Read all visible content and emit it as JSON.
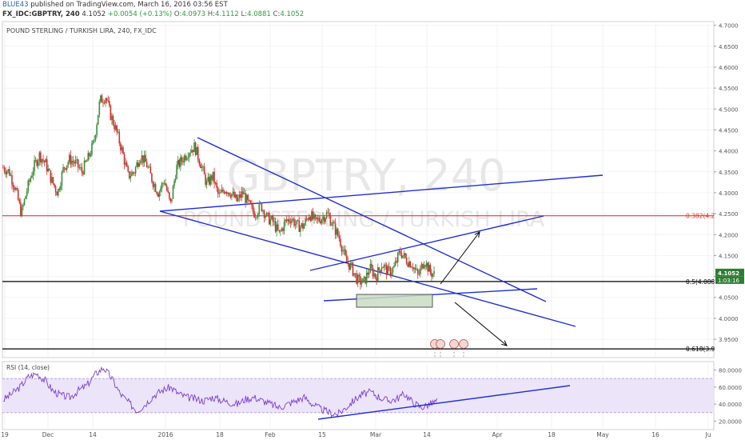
{
  "header": {
    "author": "BLUE43",
    "published_text": "published on TradingView.com, March 16, 2016 03:56 EST",
    "symbol": "FX_IDC:GBPTRY, 240",
    "last": "4.1052",
    "change": "+0.0054 (+0.13%)",
    "open_label": "O:",
    "open": "4.0973",
    "high_label": "H:",
    "high": "4.1112",
    "low_label": "L:",
    "low": "4.0881",
    "close_label": "C:",
    "close": "4.1052"
  },
  "chart_data": [
    {
      "type": "candlestick",
      "title": "POUND STERLING / TURKISH LIRA, 240, FX_IDC",
      "watermark_symbol": "GBPTRY, 240",
      "watermark_name": "POUND STERLING / TURKISH LIRA",
      "ylim": [
        3.91,
        4.705
      ],
      "y_ticks": [
        "4.7000",
        "4.6500",
        "4.6000",
        "4.5500",
        "4.5000",
        "4.4500",
        "4.4000",
        "4.3500",
        "4.3000",
        "4.2500",
        "4.2000",
        "4.1500",
        "4.1000",
        "4.0500",
        "4.0000",
        "3.9500"
      ],
      "x_ticks": [
        "19",
        "Dec",
        "14",
        "2016",
        "18",
        "Feb",
        "15",
        "Mar",
        "14",
        "Apr",
        "18",
        "May",
        "16",
        "Ju"
      ],
      "price_path": [
        [
          0,
          4.36
        ],
        [
          3,
          4.35
        ],
        [
          6,
          4.31
        ],
        [
          9,
          4.25
        ],
        [
          12,
          4.31
        ],
        [
          15,
          4.36
        ],
        [
          18,
          4.39
        ],
        [
          21,
          4.37
        ],
        [
          24,
          4.33
        ],
        [
          27,
          4.3
        ],
        [
          30,
          4.36
        ],
        [
          33,
          4.38
        ],
        [
          36,
          4.37
        ],
        [
          39,
          4.35
        ],
        [
          42,
          4.38
        ],
        [
          45,
          4.42
        ],
        [
          48,
          4.52
        ],
        [
          51,
          4.53
        ],
        [
          53,
          4.49
        ],
        [
          56,
          4.45
        ],
        [
          59,
          4.4
        ],
        [
          62,
          4.34
        ],
        [
          65,
          4.35
        ],
        [
          68,
          4.39
        ],
        [
          71,
          4.37
        ],
        [
          74,
          4.33
        ],
        [
          77,
          4.3
        ],
        [
          80,
          4.33
        ],
        [
          83,
          4.27
        ],
        [
          86,
          4.36
        ],
        [
          89,
          4.38
        ],
        [
          92,
          4.4
        ],
        [
          95,
          4.41
        ],
        [
          98,
          4.37
        ],
        [
          101,
          4.32
        ],
        [
          104,
          4.34
        ],
        [
          107,
          4.29
        ],
        [
          110,
          4.31
        ],
        [
          113,
          4.3
        ],
        [
          116,
          4.28
        ],
        [
          119,
          4.3
        ],
        [
          122,
          4.27
        ],
        [
          125,
          4.25
        ],
        [
          128,
          4.27
        ],
        [
          131,
          4.24
        ],
        [
          134,
          4.23
        ],
        [
          137,
          4.2
        ],
        [
          140,
          4.23
        ],
        [
          143,
          4.24
        ],
        [
          146,
          4.22
        ],
        [
          149,
          4.22
        ],
        [
          152,
          4.25
        ],
        [
          155,
          4.23
        ],
        [
          158,
          4.24
        ],
        [
          161,
          4.25
        ],
        [
          164,
          4.22
        ],
        [
          167,
          4.19
        ],
        [
          170,
          4.14
        ],
        [
          173,
          4.12
        ],
        [
          176,
          4.09
        ],
        [
          179,
          4.085
        ],
        [
          182,
          4.12
        ],
        [
          185,
          4.1
        ],
        [
          188,
          4.13
        ],
        [
          191,
          4.11
        ],
        [
          194,
          4.12
        ],
        [
          197,
          4.16
        ],
        [
          200,
          4.14
        ],
        [
          203,
          4.13
        ],
        [
          206,
          4.1
        ],
        [
          209,
          4.14
        ],
        [
          212,
          4.11
        ],
        [
          214,
          4.105
        ]
      ],
      "horizontal_levels": [
        {
          "label": "0.382(4.2",
          "value": 4.245,
          "color": "#e53935"
        },
        {
          "label": "0.5(4.088",
          "value": 4.088,
          "color": "#000000"
        },
        {
          "label": "0.618(3.9",
          "value": 3.927,
          "color": "#000000"
        }
      ],
      "current_price_label": "4.1052",
      "countdown_label": "1:03:16",
      "grid": true
    },
    {
      "type": "line",
      "title": "RSI (14, close)",
      "ylim": [
        10,
        90
      ],
      "y_ticks": [
        "80.0000",
        "60.0000",
        "40.0000",
        "20.0000"
      ],
      "band": [
        30,
        70
      ],
      "series": [
        {
          "values": [
            45,
            52,
            60,
            72,
            76,
            68,
            55,
            50,
            48,
            56,
            62,
            75,
            83,
            70,
            52,
            42,
            32,
            40,
            50,
            56,
            60,
            52,
            48,
            46,
            44,
            48,
            45,
            42,
            40,
            46,
            48,
            44,
            40,
            36,
            40,
            44,
            48,
            40,
            34,
            30,
            28,
            36,
            45,
            52,
            54,
            48,
            44,
            46,
            52,
            42,
            36,
            40,
            44
          ]
        }
      ]
    }
  ]
}
